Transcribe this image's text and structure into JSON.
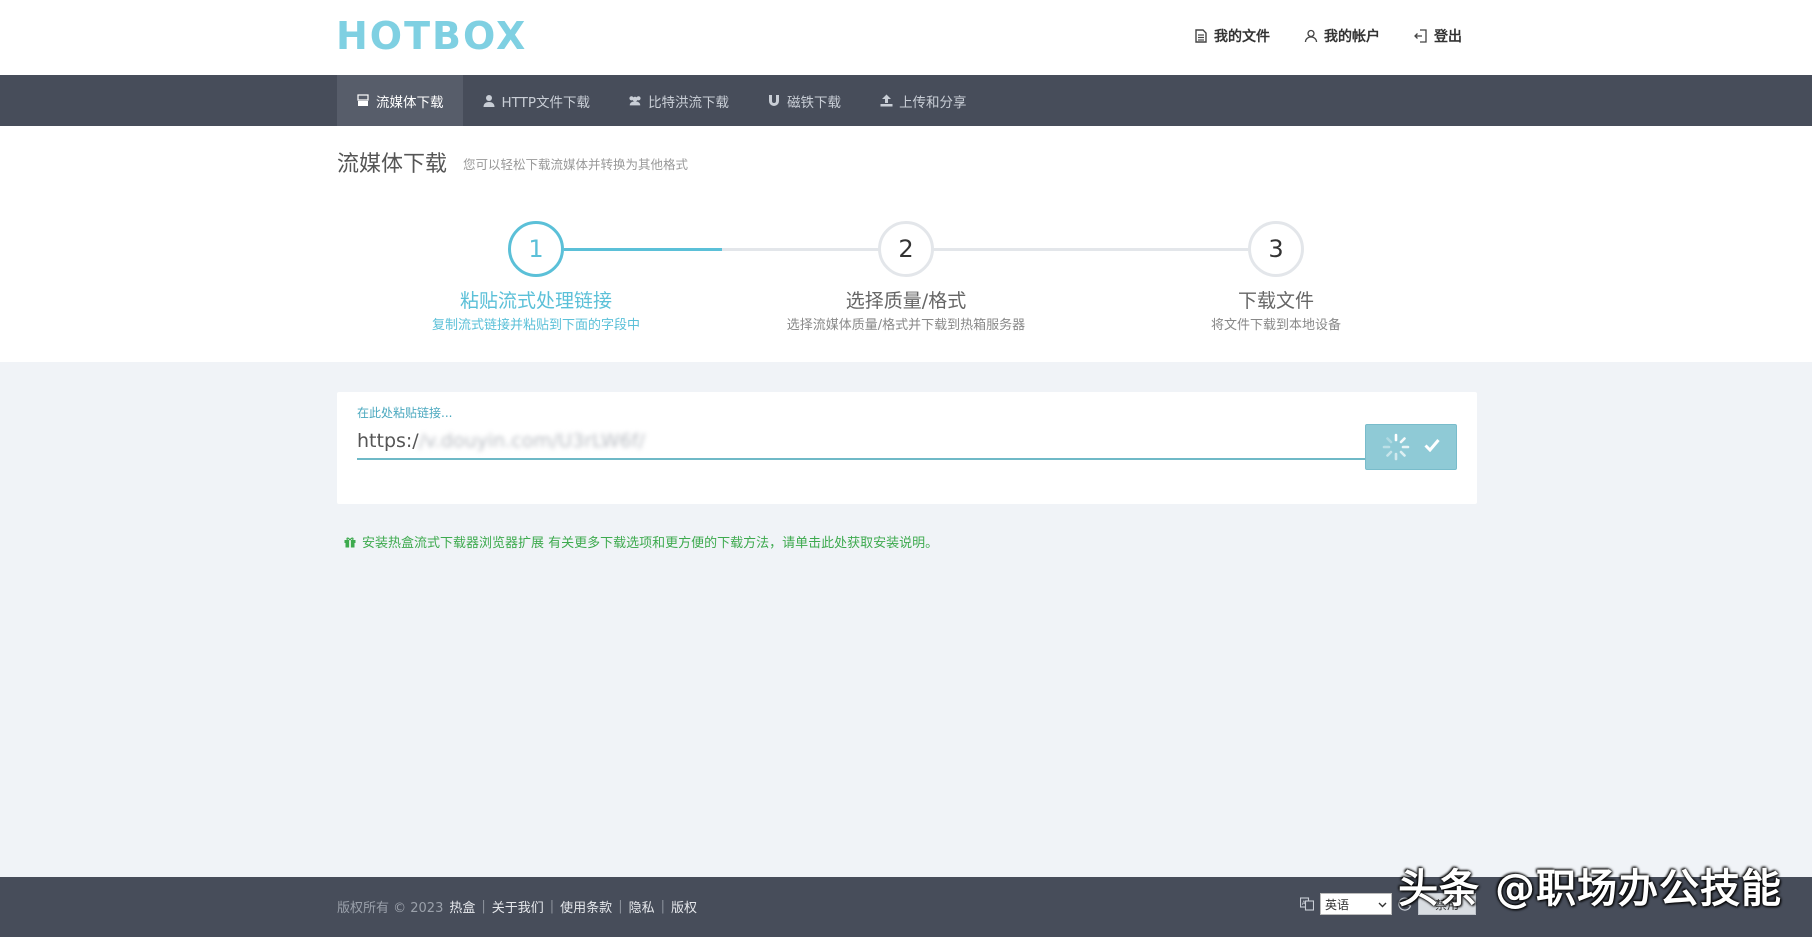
{
  "header": {
    "logo": "HOTBOX",
    "links": [
      {
        "label": "我的文件",
        "icon": "file-icon"
      },
      {
        "label": "我的帐户",
        "icon": "user-icon"
      },
      {
        "label": "登出",
        "icon": "logout-icon"
      }
    ]
  },
  "nav": {
    "items": [
      {
        "label": "流媒体下载",
        "icon": "youtube-icon",
        "active": true
      },
      {
        "label": "HTTP文件下载",
        "icon": "user-icon",
        "active": false
      },
      {
        "label": "比特洪流下载",
        "icon": "users-icon",
        "active": false
      },
      {
        "label": "磁铁下载",
        "icon": "magnet-icon",
        "active": false
      },
      {
        "label": "上传和分享",
        "icon": "upload-icon",
        "active": false
      }
    ]
  },
  "page": {
    "title": "流媒体下载",
    "subtitle": "您可以轻松下载流媒体并转换为其他格式"
  },
  "steps": [
    {
      "number": "1",
      "title": "粘贴流式处理链接",
      "desc": "复制流式链接并粘贴到下面的字段中",
      "active": true
    },
    {
      "number": "2",
      "title": "选择质量/格式",
      "desc": "选择流媒体质量/格式并下载到热箱服务器",
      "active": false
    },
    {
      "number": "3",
      "title": "下载文件",
      "desc": "将文件下载到本地设备",
      "active": false
    }
  ],
  "form": {
    "label": "在此处粘贴链接...",
    "url_prefix": "https:/",
    "url_rest": "/v.douyin.com/U3rLW6f/"
  },
  "notice": {
    "text": "安装热盒流式下载器浏览器扩展 有关更多下载选项和更方便的下载方法，请单击此处获取安装说明。"
  },
  "footer": {
    "copyright": "版权所有 © 2023",
    "brand": "热盒",
    "links": [
      "关于我们",
      "使用条款",
      "隐私",
      "版权"
    ],
    "language": "英语",
    "disable_label": "禁用"
  },
  "watermark": "头条 @职场办公技能",
  "colors": {
    "accent": "#5bc0d8",
    "nav_bg": "#474d5a",
    "notice_green": "#3daa4e",
    "logo": "#7fd0e2"
  }
}
